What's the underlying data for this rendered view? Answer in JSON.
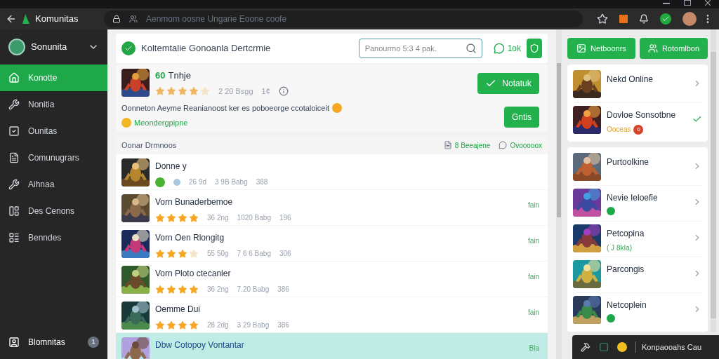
{
  "browser": {
    "app_name": "Komunitas",
    "address": "Aenmom oosne Ungarie Eoone coofe"
  },
  "sidebar": {
    "profile": "Sonunita",
    "items": [
      {
        "label": "Konotte",
        "selected": true
      },
      {
        "label": "Nonitia",
        "selected": false
      },
      {
        "label": "Ounitas",
        "selected": false
      },
      {
        "label": "Comunugrars",
        "selected": false
      },
      {
        "label": "Aihnaa",
        "selected": false
      },
      {
        "label": "Des Cenons",
        "selected": false
      },
      {
        "label": "Benndes",
        "selected": false
      }
    ],
    "footer": {
      "label": "Blomnitas",
      "badge": "1"
    }
  },
  "header": {
    "title": "Koltemtalie Gonoanla Dertcrmie",
    "search": {
      "placeholder": "Panourmo 5:3 4 pak."
    },
    "status": "1ok"
  },
  "featured": {
    "badge": "60",
    "title": "Tnhje",
    "stars": 4,
    "meta": [
      "2 20 Bsgg",
      "1¢"
    ],
    "description": "Oonneton Aeyme Reanianoost ker es poboeorge ccotaloiceit",
    "link": "Meondergpipne",
    "buttons": [
      "Notatuk",
      "Gntis"
    ]
  },
  "section": {
    "title": "Oonar Drmnoos",
    "links": [
      "8 Beeajene",
      "Ovooooox"
    ]
  },
  "rows": [
    {
      "kind": "tags",
      "title": "Donne y",
      "meta": [
        "26 9d",
        "3 9B Babg",
        "388"
      ],
      "selected": false
    },
    {
      "kind": "rated",
      "title": "Vorn Bunaderbemoe",
      "stars": 4,
      "meta": [
        "36 2ng",
        "1020 Babg",
        "196"
      ],
      "action": "fain",
      "selected": false
    },
    {
      "kind": "rated",
      "title": "Vorn Oen Rlongitg",
      "stars": 3,
      "meta": [
        "55 50g",
        "7 6 6 Babg",
        "306"
      ],
      "action": "fain",
      "selected": false
    },
    {
      "kind": "rated",
      "title": "Vorn Ploto ctecanler",
      "stars": 4,
      "meta": [
        "36 2ng",
        "7.20 Babg",
        "386"
      ],
      "action": "fain",
      "selected": false
    },
    {
      "kind": "rated",
      "title": "Oemme Dui",
      "stars": 4,
      "meta": [
        "28 2dg",
        "3 29 Babg",
        "386"
      ],
      "action": "fain",
      "selected": false
    },
    {
      "kind": "partial",
      "title": "Dbw Cotopoy Vontantar",
      "action": "Bla",
      "selected": true
    }
  ],
  "right_panel": {
    "buttons": [
      "Netboonrs",
      "Rotomlbon"
    ],
    "groups": [
      [
        {
          "title": "Nekd Online",
          "kind": "chevron"
        },
        {
          "title": "Dovloe Sonsotbne",
          "kind": "check",
          "sub": "Ooceas",
          "badge": "0"
        }
      ],
      [
        {
          "title": "Purtoolkine",
          "kind": "chevron"
        },
        {
          "title": "Nevie Ieloefie",
          "kind": "chevron",
          "online": true
        },
        {
          "title": "Petcopina",
          "kind": "chevron",
          "sub": "( J 8kIa)"
        },
        {
          "title": "Parcongis",
          "kind": "chevron"
        },
        {
          "title": "Netcoplein",
          "kind": "chevron",
          "online": true
        }
      ]
    ]
  },
  "dock": {
    "label": "Konpaooahs Cau"
  }
}
